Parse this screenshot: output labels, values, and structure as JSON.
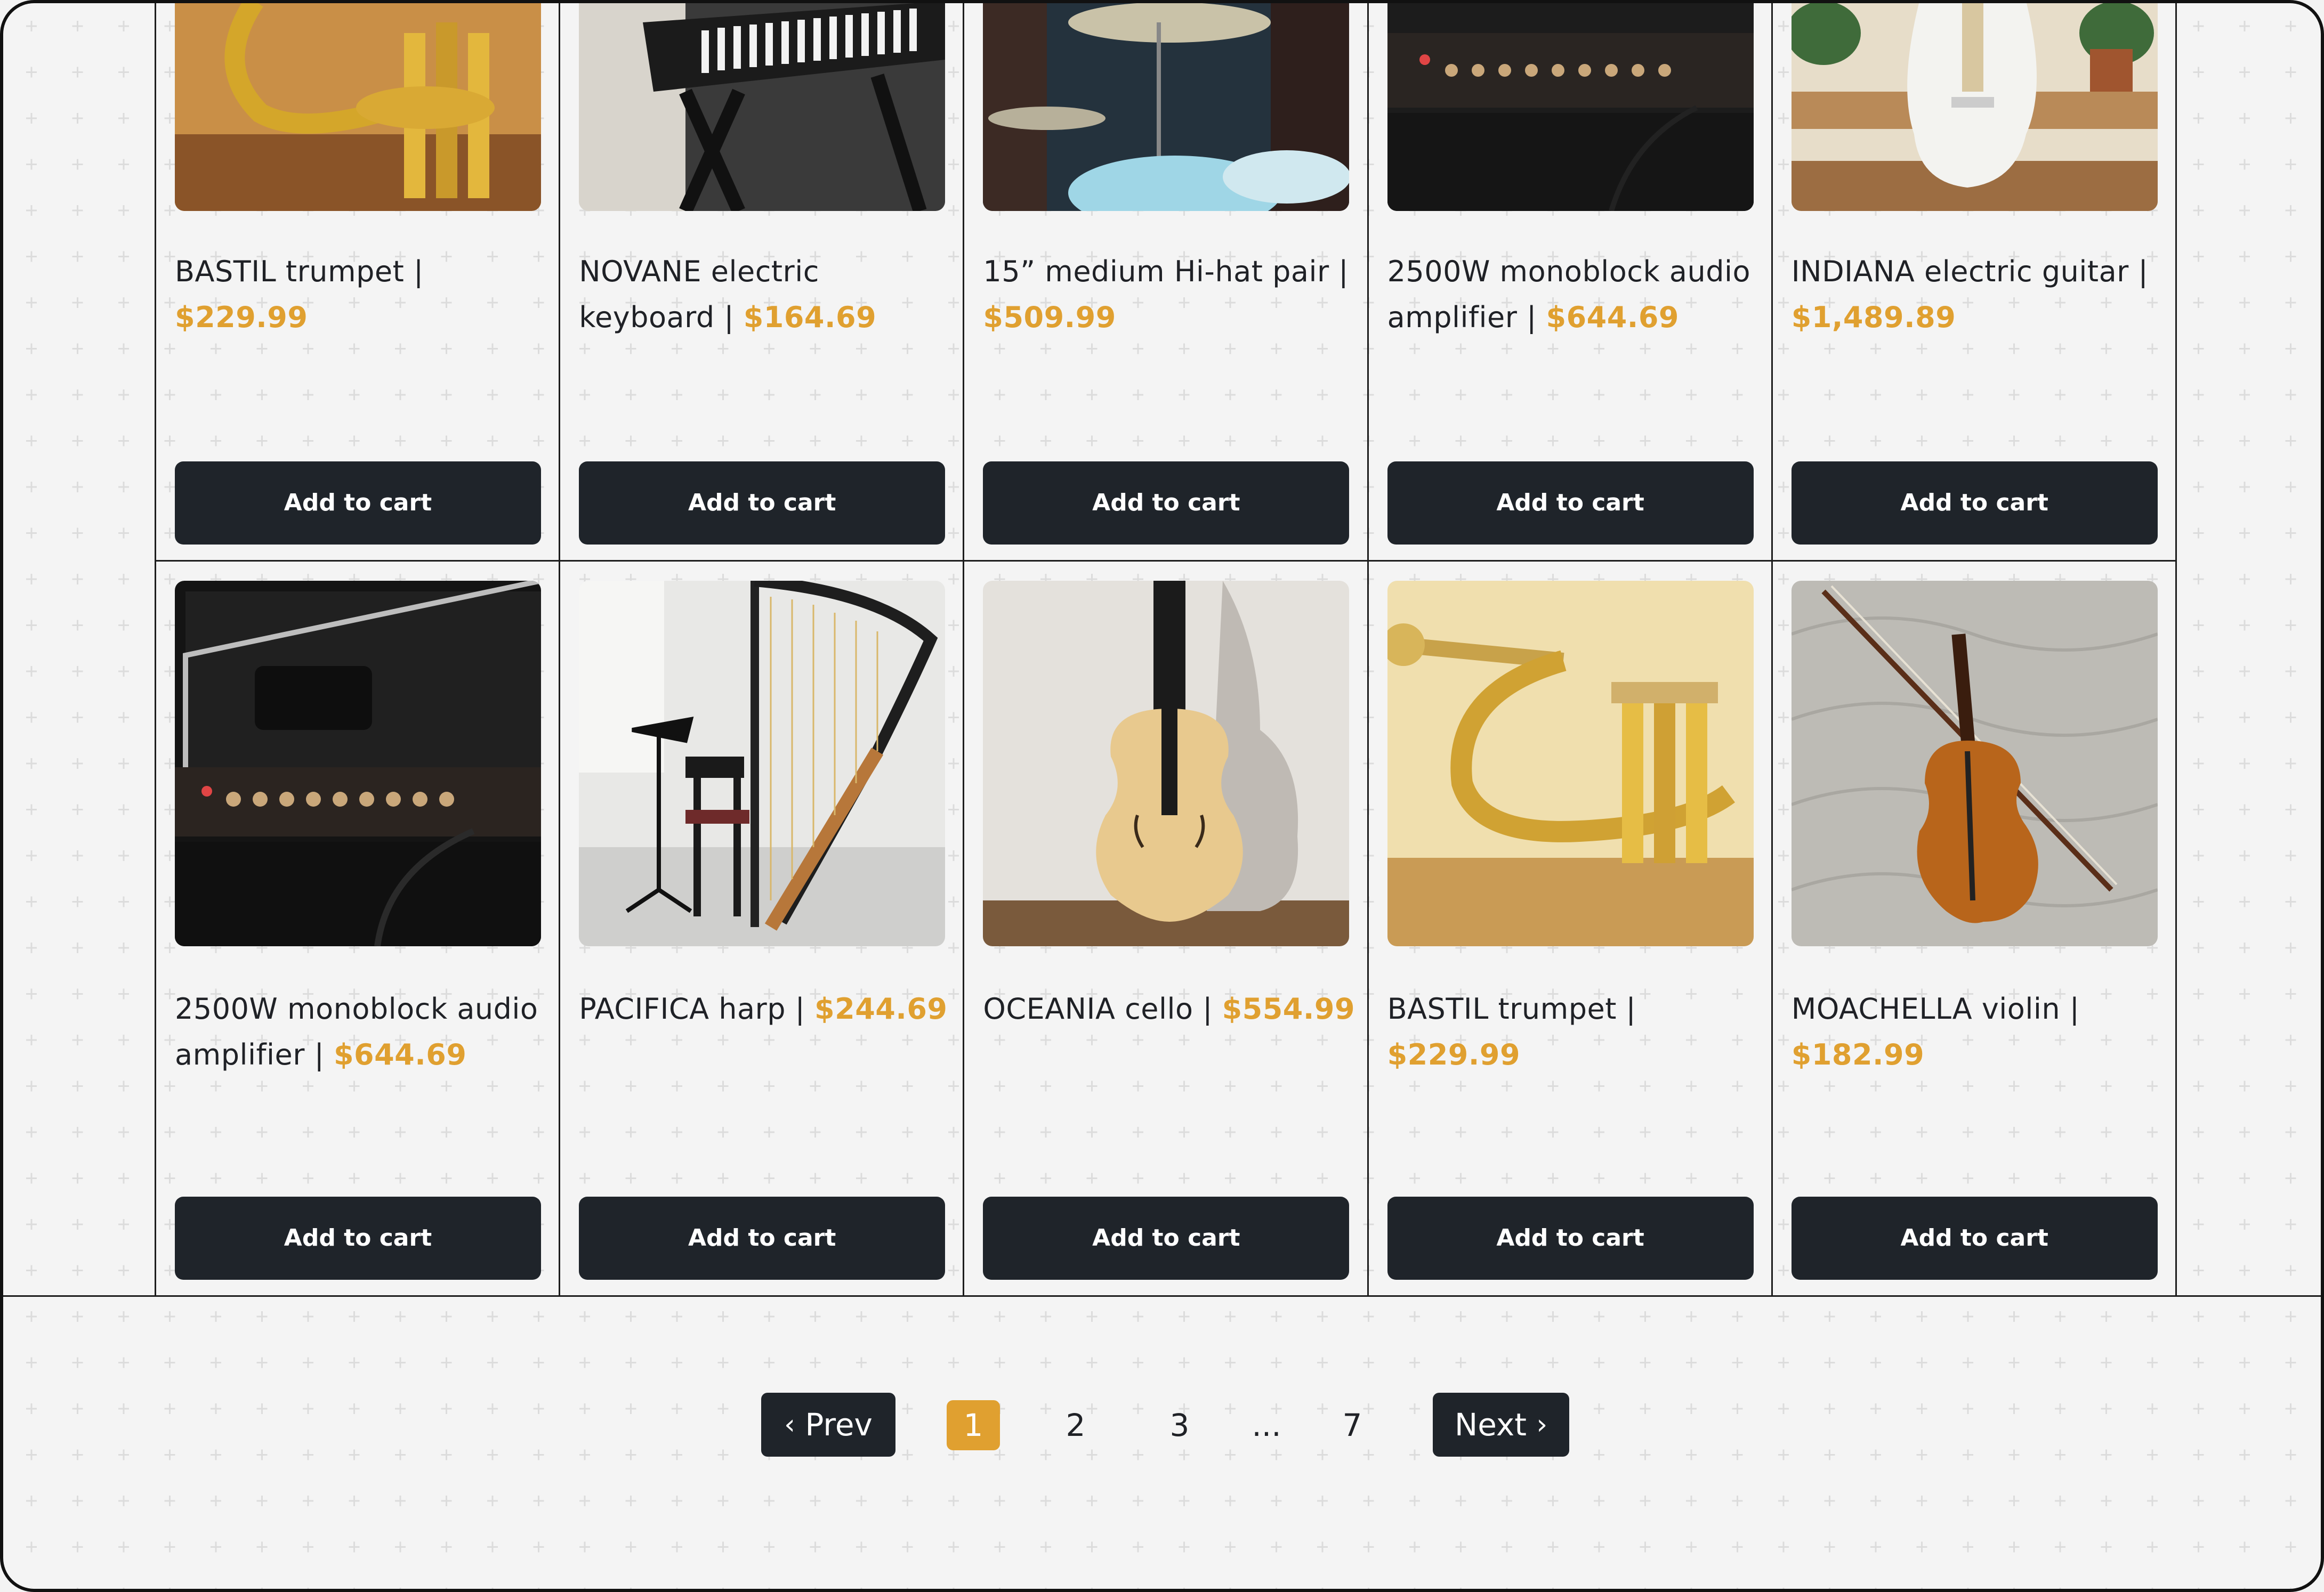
{
  "products_row1": [
    {
      "name": "BASTIL trumpet |",
      "price": "$229.99",
      "image": "trumpet",
      "button": "Add to cart"
    },
    {
      "name": "NOVANE electric keyboard |",
      "price": "$164.69",
      "image": "keyboard",
      "button": "Add to cart"
    },
    {
      "name": "15” medium Hi-hat pair |",
      "price": "$509.99",
      "image": "hi-hat",
      "button": "Add to cart"
    },
    {
      "name": "2500W monoblock audio amplifier |",
      "price": "$644.69",
      "image": "amplifier",
      "button": "Add to cart"
    },
    {
      "name": "INDIANA electric guitar |",
      "price": "$1,489.89",
      "image": "electric-guitar",
      "button": "Add to cart"
    }
  ],
  "products_row2": [
    {
      "name": "2500W monoblock audio amplifier |",
      "price": "$644.69",
      "image": "amplifier",
      "button": "Add to cart"
    },
    {
      "name": "PACIFICA harp |",
      "price": "$244.69",
      "image": "harp",
      "button": "Add to cart"
    },
    {
      "name": "OCEANIA cello |",
      "price": "$554.99",
      "image": "cello",
      "button": "Add to cart"
    },
    {
      "name": "BASTIL trumpet |",
      "price": "$229.99",
      "image": "trumpet",
      "button": "Add to cart"
    },
    {
      "name": "MOACHELLA violin |",
      "price": "$182.99",
      "image": "violin",
      "button": "Add to cart"
    }
  ],
  "pagination": {
    "prev_label": "Prev",
    "next_label": "Next",
    "pages": [
      "1",
      "2",
      "3",
      "...",
      "7"
    ],
    "current": "1"
  },
  "colors": {
    "accent": "#e0a030",
    "button_bg": "#1f242a",
    "text": "#1f2126"
  }
}
